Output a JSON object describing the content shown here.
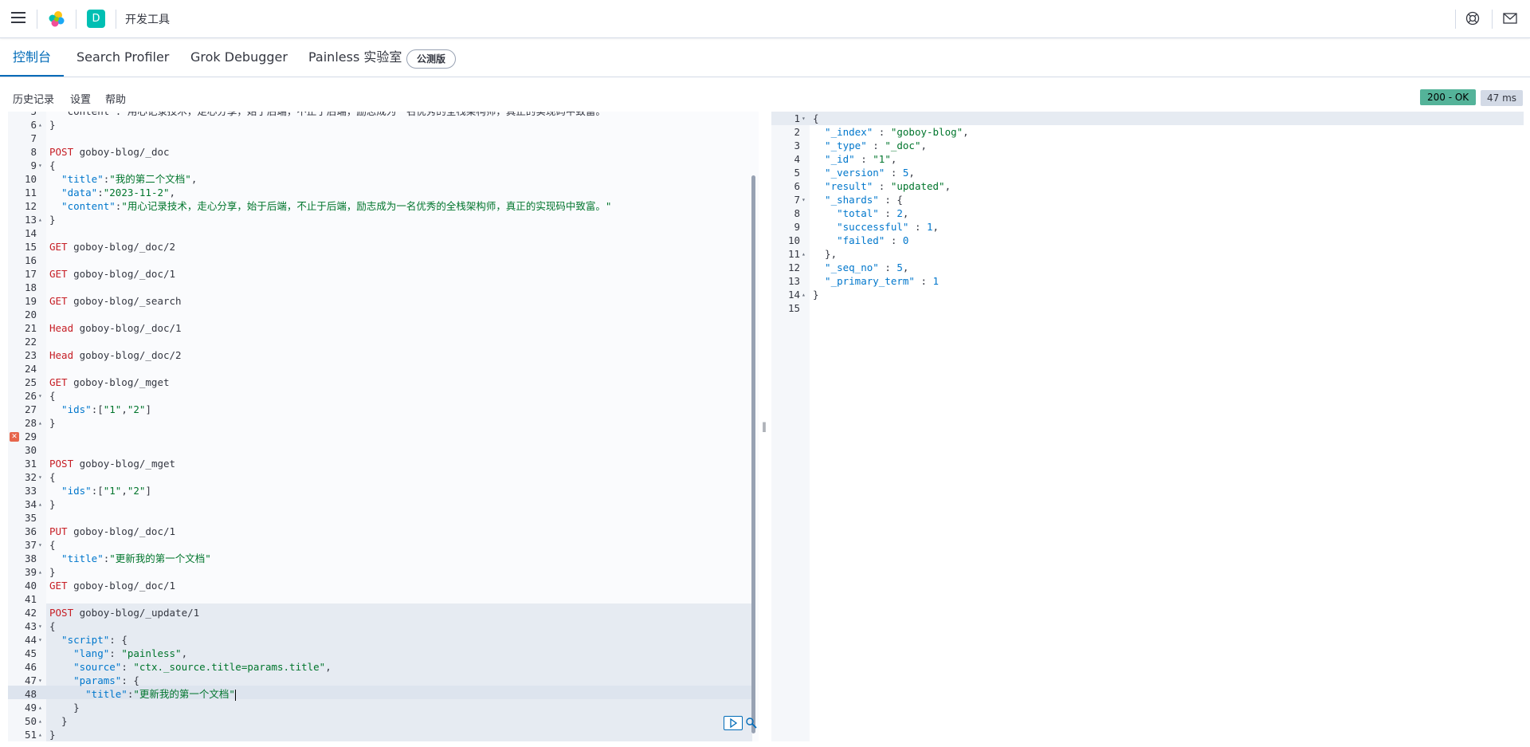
{
  "header": {
    "breadcrumb": "开发工具",
    "space_initial": "D"
  },
  "tabs": [
    {
      "label": "控制台",
      "active": true
    },
    {
      "label": "Search Profiler",
      "active": false
    },
    {
      "label": "Grok Debugger",
      "active": false
    },
    {
      "label": "Painless 实验室",
      "active": false
    }
  ],
  "beta_badge": "公测版",
  "toolbar": {
    "history": "历史记录",
    "settings": "设置",
    "help": "帮助"
  },
  "response_status": {
    "status": "200 - OK",
    "time": "47 ms"
  },
  "request_lines": [
    {
      "n": "5",
      "fold": "",
      "tokens": [
        [
          "p",
          "  \"content\":\"用心记录技术，走心分享，始于后端，不止于后端，励志成为一名优秀的全栈架构师，真正的实现码中致富。\""
        ]
      ]
    },
    {
      "n": "6",
      "fold": "▴",
      "tokens": [
        [
          "p",
          "}"
        ]
      ]
    },
    {
      "n": "7",
      "fold": "",
      "tokens": []
    },
    {
      "n": "8",
      "fold": "",
      "tokens": [
        [
          "m",
          "POST"
        ],
        [
          "u",
          " goboy-blog/_doc"
        ]
      ]
    },
    {
      "n": "9",
      "fold": "▾",
      "tokens": [
        [
          "p",
          "{"
        ]
      ]
    },
    {
      "n": "10",
      "fold": "",
      "tokens": [
        [
          "k",
          "  \"title\""
        ],
        [
          "p",
          ":"
        ],
        [
          "s",
          "\"我的第二个文档\""
        ],
        [
          "p",
          ","
        ]
      ]
    },
    {
      "n": "11",
      "fold": "",
      "tokens": [
        [
          "k",
          "  \"data\""
        ],
        [
          "p",
          ":"
        ],
        [
          "s",
          "\"2023-11-2\""
        ],
        [
          "p",
          ","
        ]
      ]
    },
    {
      "n": "12",
      "fold": "",
      "tokens": [
        [
          "k",
          "  \"content\""
        ],
        [
          "p",
          ":"
        ],
        [
          "s",
          "\"用心记录技术，走心分享，始于后端，不止于后端，励志成为一名优秀的全栈架构师，真正的实现码中致富。\""
        ]
      ]
    },
    {
      "n": "13",
      "fold": "▴",
      "tokens": [
        [
          "p",
          "}"
        ]
      ]
    },
    {
      "n": "14",
      "fold": "",
      "tokens": []
    },
    {
      "n": "15",
      "fold": "",
      "tokens": [
        [
          "m",
          "GET"
        ],
        [
          "u",
          " goboy-blog/_doc/2"
        ]
      ]
    },
    {
      "n": "16",
      "fold": "",
      "tokens": []
    },
    {
      "n": "17",
      "fold": "",
      "tokens": [
        [
          "m",
          "GET"
        ],
        [
          "u",
          " goboy-blog/_doc/1"
        ]
      ]
    },
    {
      "n": "18",
      "fold": "",
      "tokens": []
    },
    {
      "n": "19",
      "fold": "",
      "tokens": [
        [
          "m",
          "GET"
        ],
        [
          "u",
          " goboy-blog/_search"
        ]
      ]
    },
    {
      "n": "20",
      "fold": "",
      "tokens": []
    },
    {
      "n": "21",
      "fold": "",
      "tokens": [
        [
          "m",
          "Head"
        ],
        [
          "u",
          " goboy-blog/_doc/1"
        ]
      ]
    },
    {
      "n": "22",
      "fold": "",
      "tokens": []
    },
    {
      "n": "23",
      "fold": "",
      "tokens": [
        [
          "m",
          "Head"
        ],
        [
          "u",
          " goboy-blog/_doc/2"
        ]
      ]
    },
    {
      "n": "24",
      "fold": "",
      "tokens": []
    },
    {
      "n": "25",
      "fold": "",
      "tokens": [
        [
          "m",
          "GET"
        ],
        [
          "u",
          " goboy-blog/_mget"
        ]
      ]
    },
    {
      "n": "26",
      "fold": "▾",
      "tokens": [
        [
          "p",
          "{"
        ]
      ]
    },
    {
      "n": "27",
      "fold": "",
      "tokens": [
        [
          "k",
          "  \"ids\""
        ],
        [
          "p",
          ":["
        ],
        [
          "s",
          "\"1\""
        ],
        [
          "p",
          ","
        ],
        [
          "s",
          "\"2\""
        ],
        [
          "p",
          "]"
        ]
      ]
    },
    {
      "n": "28",
      "fold": "▴",
      "tokens": [
        [
          "p",
          "}"
        ]
      ]
    },
    {
      "n": "29",
      "fold": "",
      "tokens": []
    },
    {
      "n": "30",
      "fold": "",
      "tokens": []
    },
    {
      "n": "31",
      "fold": "",
      "tokens": [
        [
          "m",
          "POST"
        ],
        [
          "u",
          " goboy-blog/_mget"
        ]
      ]
    },
    {
      "n": "32",
      "fold": "▾",
      "tokens": [
        [
          "p",
          "{"
        ]
      ]
    },
    {
      "n": "33",
      "fold": "",
      "tokens": [
        [
          "k",
          "  \"ids\""
        ],
        [
          "p",
          ":["
        ],
        [
          "s",
          "\"1\""
        ],
        [
          "p",
          ","
        ],
        [
          "s",
          "\"2\""
        ],
        [
          "p",
          "]"
        ]
      ]
    },
    {
      "n": "34",
      "fold": "▴",
      "tokens": [
        [
          "p",
          "}"
        ]
      ]
    },
    {
      "n": "35",
      "fold": "",
      "tokens": []
    },
    {
      "n": "36",
      "fold": "",
      "tokens": [
        [
          "m",
          "PUT"
        ],
        [
          "u",
          " goboy-blog/_doc/1"
        ]
      ]
    },
    {
      "n": "37",
      "fold": "▾",
      "tokens": [
        [
          "p",
          "{"
        ]
      ]
    },
    {
      "n": "38",
      "fold": "",
      "tokens": [
        [
          "k",
          "  \"title\""
        ],
        [
          "p",
          ":"
        ],
        [
          "s",
          "\"更新我的第一个文档\""
        ]
      ]
    },
    {
      "n": "39",
      "fold": "▴",
      "tokens": [
        [
          "p",
          "}"
        ]
      ]
    },
    {
      "n": "40",
      "fold": "",
      "tokens": [
        [
          "m",
          "GET"
        ],
        [
          "u",
          " goboy-blog/_doc/1"
        ]
      ]
    },
    {
      "n": "41",
      "fold": "",
      "tokens": []
    },
    {
      "n": "42",
      "fold": "",
      "tokens": [
        [
          "m",
          "POST"
        ],
        [
          "u",
          " goboy-blog/_update/1"
        ]
      ]
    },
    {
      "n": "43",
      "fold": "▾",
      "tokens": [
        [
          "p",
          "{"
        ]
      ]
    },
    {
      "n": "44",
      "fold": "▾",
      "tokens": [
        [
          "k",
          "  \"script\""
        ],
        [
          "p",
          ": {"
        ]
      ]
    },
    {
      "n": "45",
      "fold": "",
      "tokens": [
        [
          "k",
          "    \"lang\""
        ],
        [
          "p",
          ": "
        ],
        [
          "s",
          "\"painless\""
        ],
        [
          "p",
          ","
        ]
      ]
    },
    {
      "n": "46",
      "fold": "",
      "tokens": [
        [
          "k",
          "    \"source\""
        ],
        [
          "p",
          ": "
        ],
        [
          "s",
          "\"ctx._source.title=params.title\""
        ],
        [
          "p",
          ","
        ]
      ]
    },
    {
      "n": "47",
      "fold": "▾",
      "tokens": [
        [
          "k",
          "    \"params\""
        ],
        [
          "p",
          ": {"
        ]
      ]
    },
    {
      "n": "48",
      "fold": "",
      "tokens": [
        [
          "k",
          "      \"title\""
        ],
        [
          "p",
          ":"
        ],
        [
          "s",
          "\"更新我的第一个文档\""
        ]
      ]
    },
    {
      "n": "49",
      "fold": "▴",
      "tokens": [
        [
          "p",
          "    }"
        ]
      ]
    },
    {
      "n": "50",
      "fold": "▴",
      "tokens": [
        [
          "p",
          "  }"
        ]
      ]
    },
    {
      "n": "51",
      "fold": "▴",
      "tokens": [
        [
          "p",
          "}"
        ]
      ]
    }
  ],
  "response_lines": [
    {
      "n": "1",
      "fold": "▾",
      "tokens": [
        [
          "p",
          "{"
        ]
      ]
    },
    {
      "n": "2",
      "fold": "",
      "tokens": [
        [
          "k",
          "  \"_index\""
        ],
        [
          "p",
          " : "
        ],
        [
          "s",
          "\"goboy-blog\""
        ],
        [
          "p",
          ","
        ]
      ]
    },
    {
      "n": "3",
      "fold": "",
      "tokens": [
        [
          "k",
          "  \"_type\""
        ],
        [
          "p",
          " : "
        ],
        [
          "s",
          "\"_doc\""
        ],
        [
          "p",
          ","
        ]
      ]
    },
    {
      "n": "4",
      "fold": "",
      "tokens": [
        [
          "k",
          "  \"_id\""
        ],
        [
          "p",
          " : "
        ],
        [
          "s",
          "\"1\""
        ],
        [
          "p",
          ","
        ]
      ]
    },
    {
      "n": "5",
      "fold": "",
      "tokens": [
        [
          "k",
          "  \"_version\""
        ],
        [
          "p",
          " : "
        ],
        [
          "n",
          "5"
        ],
        [
          "p",
          ","
        ]
      ]
    },
    {
      "n": "6",
      "fold": "",
      "tokens": [
        [
          "k",
          "  \"result\""
        ],
        [
          "p",
          " : "
        ],
        [
          "s",
          "\"updated\""
        ],
        [
          "p",
          ","
        ]
      ]
    },
    {
      "n": "7",
      "fold": "▾",
      "tokens": [
        [
          "k",
          "  \"_shards\""
        ],
        [
          "p",
          " : {"
        ]
      ]
    },
    {
      "n": "8",
      "fold": "",
      "tokens": [
        [
          "k",
          "    \"total\""
        ],
        [
          "p",
          " : "
        ],
        [
          "n",
          "2"
        ],
        [
          "p",
          ","
        ]
      ]
    },
    {
      "n": "9",
      "fold": "",
      "tokens": [
        [
          "k",
          "    \"successful\""
        ],
        [
          "p",
          " : "
        ],
        [
          "n",
          "1"
        ],
        [
          "p",
          ","
        ]
      ]
    },
    {
      "n": "10",
      "fold": "",
      "tokens": [
        [
          "k",
          "    \"failed\""
        ],
        [
          "p",
          " : "
        ],
        [
          "n",
          "0"
        ]
      ]
    },
    {
      "n": "11",
      "fold": "▴",
      "tokens": [
        [
          "p",
          "  },"
        ]
      ]
    },
    {
      "n": "12",
      "fold": "",
      "tokens": [
        [
          "k",
          "  \"_seq_no\""
        ],
        [
          "p",
          " : "
        ],
        [
          "n",
          "5"
        ],
        [
          "p",
          ","
        ]
      ]
    },
    {
      "n": "13",
      "fold": "",
      "tokens": [
        [
          "k",
          "  \"_primary_term\""
        ],
        [
          "p",
          " : "
        ],
        [
          "n",
          "1"
        ]
      ]
    },
    {
      "n": "14",
      "fold": "▴",
      "tokens": [
        [
          "p",
          "}"
        ]
      ]
    },
    {
      "n": "15",
      "fold": "",
      "tokens": []
    }
  ]
}
